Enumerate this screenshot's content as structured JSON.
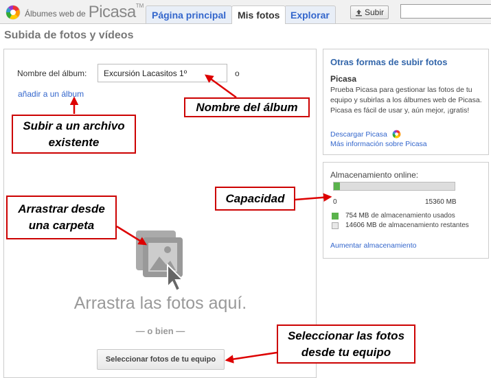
{
  "header": {
    "logo_prefix": "Álbumes web de",
    "logo_main": "Picasa",
    "logo_tm": "TM",
    "tabs": [
      {
        "label": "Página principal"
      },
      {
        "label": "Mis fotos"
      },
      {
        "label": "Explorar"
      }
    ],
    "upload_label": "Subir"
  },
  "page": {
    "title": "Subida de fotos y vídeos"
  },
  "upload": {
    "album_label": "Nombre del álbum:",
    "album_value": "Excursión Lacasitos 1º",
    "or_small": "o",
    "add_to_album": "añadir a un álbum",
    "drop_text": "Arrastra las fotos aquí.",
    "or_bien": "— o bien —",
    "select_button": "Seleccionar fotos de tu equipo"
  },
  "sidebar": {
    "title": "Otras formas de subir fotos",
    "subtitle": "Picasa",
    "description": "Prueba Picasa para gestionar las fotos de tu equipo y subirlas a los álbumes web de Picasa. Picasa es fácil de usar y, aún mejor, ¡gratis!",
    "download_link": "Descargar Picasa",
    "more_info_link": "Más información sobre Picasa"
  },
  "storage": {
    "label": "Almacenamiento online:",
    "min": "0",
    "max": "15360 MB",
    "used_fraction": 0.049,
    "used_value": "754 MB",
    "used_text": "de almacenamiento usados",
    "free_value": "14606 MB",
    "free_text": "de almacenamiento restantes",
    "increase_link": "Aumentar almacenamiento"
  },
  "annotations": {
    "album_name": "Nombre del álbum",
    "existing_line1": "Subir a un archivo",
    "existing_line2": "existente",
    "capacity": "Capacidad",
    "drag_line1": "Arrastrar desde",
    "drag_line2": "una carpeta",
    "select_line1": "Seleccionar las fotos",
    "select_line2": "desde tu equipo"
  },
  "colors": {
    "link": "#3366cc",
    "storage_used": "#5ab34c",
    "callout_border": "#cc0000"
  }
}
